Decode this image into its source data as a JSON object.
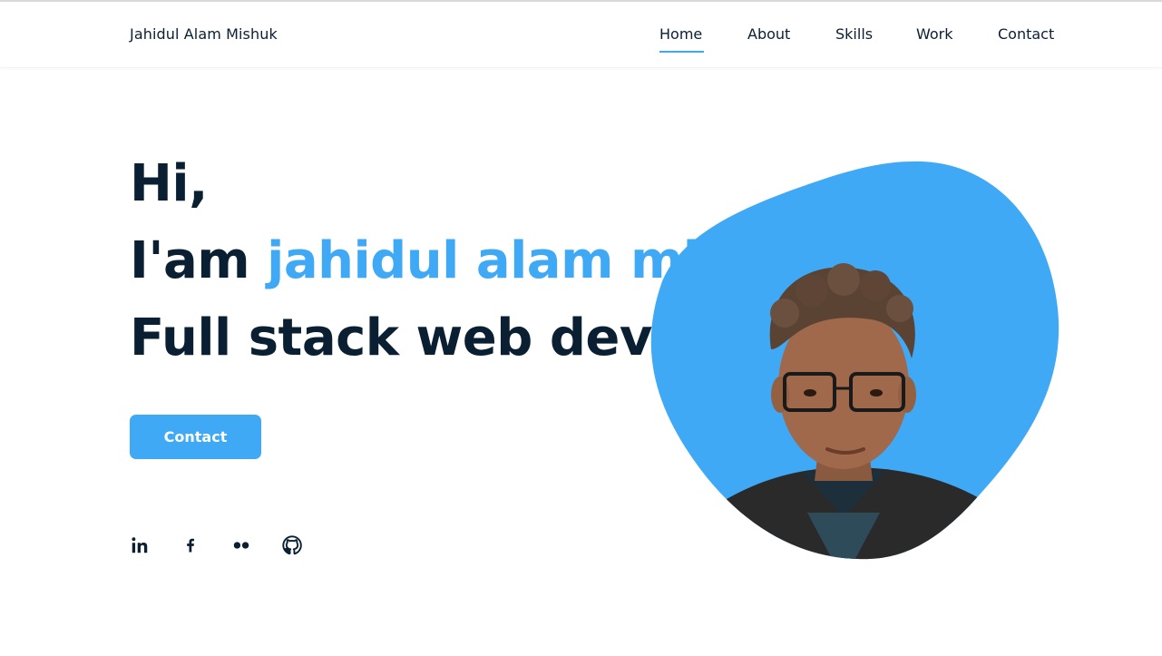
{
  "header": {
    "logo": "Jahidul Alam Mishuk",
    "nav": [
      {
        "label": "Home",
        "active": true
      },
      {
        "label": "About"
      },
      {
        "label": "Skills"
      },
      {
        "label": "Work"
      },
      {
        "label": "Contact"
      }
    ]
  },
  "hero": {
    "greeting": "Hi,",
    "intro_prefix": "I'am ",
    "name": "jahidul alam mishuk",
    "role": "Full stack web developer",
    "button_label": "Contact"
  },
  "social": [
    {
      "icon": "linkedin-icon"
    },
    {
      "icon": "facebook-icon"
    },
    {
      "icon": "flickr-icon"
    },
    {
      "icon": "github-icon"
    }
  ],
  "colors": {
    "accent": "#3fa9f5",
    "text": "#0b1f33"
  }
}
